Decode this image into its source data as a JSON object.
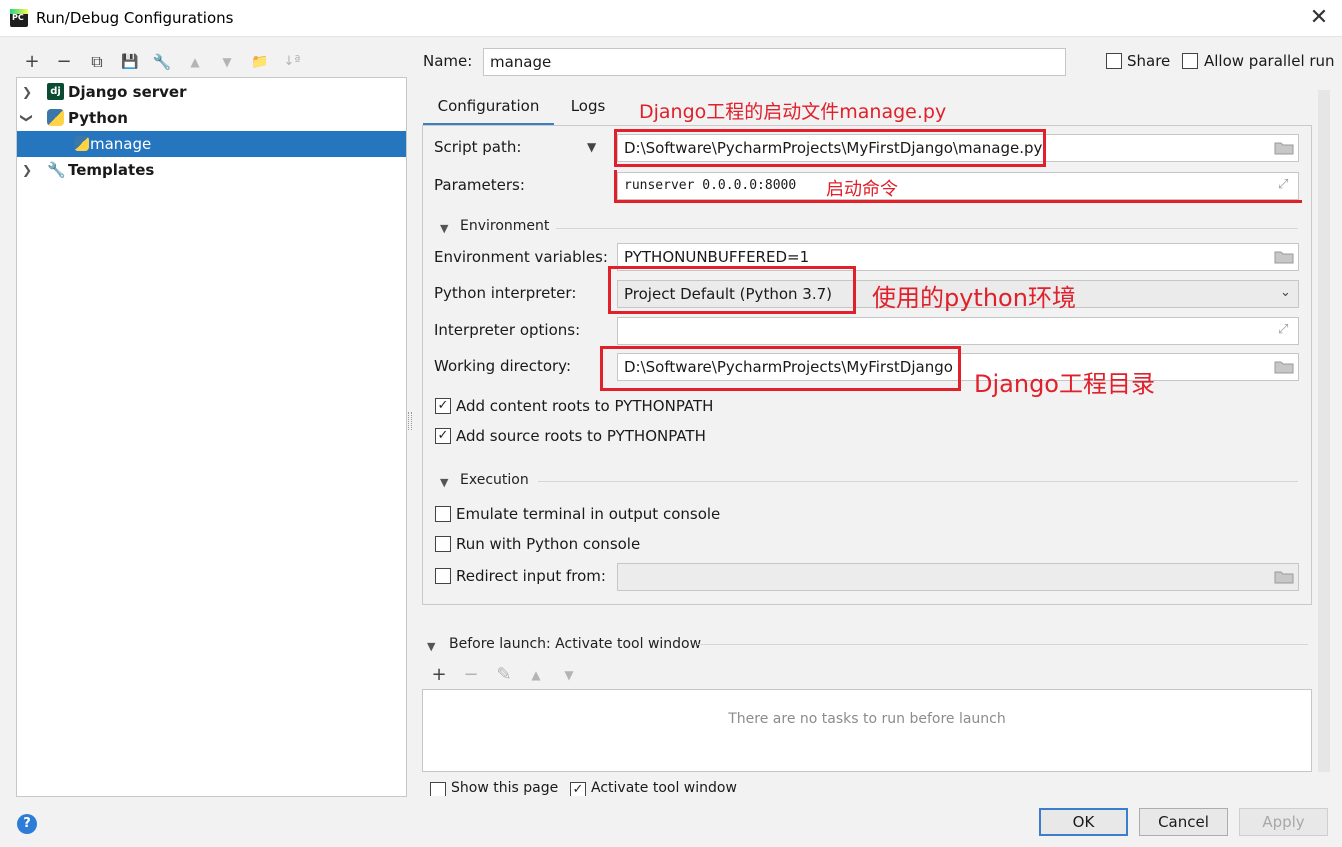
{
  "window": {
    "title": "Run/Debug Configurations",
    "app_icon_text": "PC"
  },
  "toolbar": {
    "add": "+",
    "remove": "−",
    "copy": "⧉",
    "save": "💾",
    "edit": "🔧",
    "up": "▲",
    "down": "▼",
    "folder": "📁",
    "sort": "↓ª"
  },
  "tree": {
    "items": [
      {
        "label": "Django server",
        "icon_text": "dj"
      },
      {
        "label": "Python"
      },
      {
        "label": "manage"
      },
      {
        "label": "Templates"
      }
    ]
  },
  "header": {
    "name_label": "Name:",
    "name_value": "manage",
    "share_label": "Share",
    "parallel_label": "Allow parallel run"
  },
  "tabs": [
    {
      "label": "Configuration"
    },
    {
      "label": "Logs"
    }
  ],
  "form": {
    "script_path_label": "Script path:",
    "script_path_value": "D:\\Software\\PycharmProjects\\MyFirstDjango\\manage.py",
    "parameters_label": "Parameters:",
    "parameters_value": "runserver 0.0.0.0:8000",
    "environment_section": "Environment",
    "env_vars_label": "Environment variables:",
    "env_vars_value": "PYTHONUNBUFFERED=1",
    "interpreter_label": "Python interpreter:",
    "interpreter_value": "Project Default (Python 3.7)",
    "interp_options_label": "Interpreter options:",
    "interp_options_value": "",
    "working_dir_label": "Working directory:",
    "working_dir_value": "D:\\Software\\PycharmProjects\\MyFirstDjango",
    "content_roots_label": "Add content roots to PYTHONPATH",
    "source_roots_label": "Add source roots to PYTHONPATH",
    "execution_section": "Execution",
    "emulate_terminal_label": "Emulate terminal in output console",
    "python_console_label": "Run with Python console",
    "redirect_input_label": "Redirect input from:"
  },
  "before_launch": {
    "title": "Before launch: Activate tool window",
    "add": "+",
    "remove": "−",
    "edit": "✎",
    "up": "▲",
    "down": "▼",
    "empty_text": "There are no tasks to run before launch",
    "show_page_label": "Show this page",
    "activate_label": "Activate tool window"
  },
  "annotations": {
    "script": "Django工程的启动文件manage.py",
    "params": "启动命令",
    "interpreter": "使用的python环境",
    "workdir": "Django工程目录"
  },
  "buttons": {
    "ok": "OK",
    "cancel": "Cancel",
    "apply": "Apply",
    "help": "?"
  },
  "colors": {
    "selection": "#2675bf",
    "annotation_red": "#e0202a",
    "tab_underline": "#3d7fc1"
  }
}
